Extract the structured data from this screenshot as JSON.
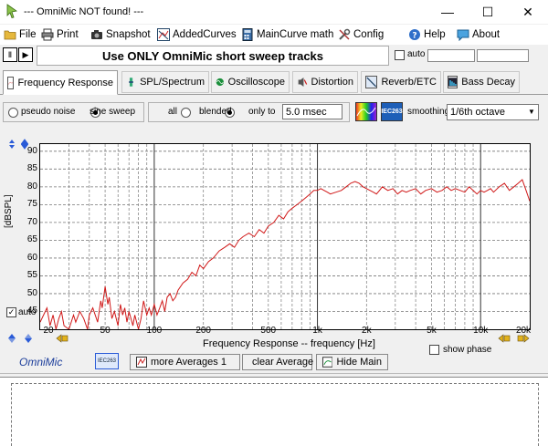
{
  "window": {
    "title": "--- OmniMic NOT found! ---",
    "minimize": "—",
    "maximize": "☐",
    "close": "✕"
  },
  "menu": {
    "items": [
      {
        "label": "File",
        "icon": "folder-icon"
      },
      {
        "label": "Print",
        "icon": "printer-icon"
      },
      {
        "label": "Snapshot",
        "icon": "camera-icon"
      },
      {
        "label": "AddedCurves",
        "icon": "curves-icon"
      },
      {
        "label": "MainCurve math",
        "icon": "calculator-icon"
      },
      {
        "label": "Config",
        "icon": "tools-icon"
      },
      {
        "label": "Help",
        "icon": "help-icon"
      },
      {
        "label": "About",
        "icon": "chat-icon"
      }
    ]
  },
  "toolbar": {
    "pause_glyph": "Ⅱ",
    "play_glyph": "▶",
    "banner": "Use ONLY OmniMic short sweep tracks",
    "auto_label": "auto"
  },
  "tabs": [
    {
      "label": "Frequency Response",
      "icon": "freq-response-icon",
      "active": true
    },
    {
      "label": "SPL/Spectrum",
      "icon": "spl-icon",
      "active": false
    },
    {
      "label": "Oscilloscope",
      "icon": "oscilloscope-icon",
      "active": false
    },
    {
      "label": "Distortion",
      "icon": "distortion-icon",
      "active": false
    },
    {
      "label": "Reverb/ETC",
      "icon": "reverb-icon",
      "active": false
    },
    {
      "label": "Bass Decay",
      "icon": "bass-decay-icon",
      "active": false
    }
  ],
  "options": {
    "pseudo_noise": "pseudo noise",
    "sine_sweep": "sine sweep",
    "all": "all",
    "blended": "blended",
    "only_to": "only to",
    "msec_value": "5.0 msec",
    "smoothing_label": "smoothing",
    "smoothing_value": "1/6th octave",
    "iec_label": "IEC263"
  },
  "chart_labels": {
    "ylabel": "[dBSPL]",
    "xlabel": "Frequency Response -- frequency [Hz]",
    "auto": "auto",
    "show_phase": "show phase"
  },
  "chart_data": {
    "type": "line",
    "xlabel": "Frequency Response -- frequency [Hz]",
    "ylabel": "[dBSPL]",
    "xscale": "log",
    "xlim": [
      20,
      20000
    ],
    "ylim": [
      40,
      92
    ],
    "xticks": [
      "20",
      "50",
      "100",
      "200",
      "500",
      "1k",
      "2k",
      "5k",
      "10k",
      "20k"
    ],
    "xtick_values": [
      20,
      50,
      100,
      200,
      500,
      1000,
      2000,
      5000,
      10000,
      20000
    ],
    "yticks": [
      45,
      50,
      55,
      60,
      65,
      70,
      75,
      80,
      85,
      90
    ],
    "grid": true,
    "series": [
      {
        "color": "#d01818",
        "x": [
          20,
          22,
          23,
          24,
          25,
          26,
          27,
          28,
          30,
          32,
          33,
          35,
          37,
          39,
          40,
          42,
          45,
          47,
          48,
          50,
          52,
          53,
          55,
          57,
          60,
          62,
          64,
          66,
          68,
          70,
          72,
          74,
          76,
          78,
          80,
          83,
          86,
          90,
          93,
          96,
          100,
          104,
          108,
          112,
          116,
          120,
          125,
          130,
          135,
          140,
          150,
          160,
          170,
          180,
          190,
          200,
          215,
          230,
          250,
          270,
          290,
          310,
          330,
          350,
          380,
          410,
          440,
          470,
          500,
          540,
          580,
          620,
          660,
          700,
          750,
          800,
          850,
          900,
          950,
          1000,
          1050,
          1100,
          1150,
          1200,
          1300,
          1400,
          1500,
          1600,
          1700,
          1800,
          1900,
          2000,
          2100,
          2200,
          2300,
          2400,
          2500,
          2700,
          2900,
          3100,
          3300,
          3500,
          3700,
          4000,
          4300,
          4600,
          5000,
          5400,
          5800,
          6200,
          6600,
          7000,
          7500,
          8000,
          8500,
          9000,
          9500,
          10000,
          10500,
          11000,
          11500,
          12000,
          13000,
          14000,
          15000,
          16000,
          17000,
          18000,
          19000,
          20000
        ],
        "y": [
          42,
          46,
          41,
          44,
          40,
          43,
          45,
          41,
          40,
          44,
          42,
          45,
          43,
          40,
          44,
          46,
          42,
          48,
          46,
          52,
          47,
          49,
          43,
          45,
          41,
          47,
          44,
          46,
          42,
          45,
          43,
          41,
          44,
          42,
          40,
          43,
          48,
          44,
          46,
          44,
          47,
          44,
          46,
          48,
          45,
          49,
          50,
          48,
          49,
          51,
          53,
          54,
          56,
          55,
          58,
          57,
          59,
          60,
          62,
          63,
          64,
          63,
          65,
          66,
          67,
          66,
          68,
          67,
          69,
          70,
          72,
          71,
          73,
          74,
          75,
          76,
          77,
          78,
          79,
          79,
          79.5,
          79,
          78.5,
          78,
          78.5,
          79,
          80,
          81,
          81.5,
          81,
          80,
          79.5,
          79,
          78.5,
          78,
          79,
          80,
          79,
          79.5,
          78,
          79,
          78.5,
          79,
          79.5,
          78,
          79,
          79.5,
          78.5,
          79,
          80,
          79,
          79.5,
          79,
          78.5,
          80,
          79,
          78,
          79,
          78.5,
          79,
          79.5,
          78.5,
          80,
          81,
          79,
          80,
          81,
          82,
          79,
          76
        ]
      }
    ]
  },
  "buttons": {
    "omnimic": "OmniMic",
    "more_averages": "more Averages 1",
    "clear_average": "clear Average",
    "hide_main": "Hide Main"
  }
}
